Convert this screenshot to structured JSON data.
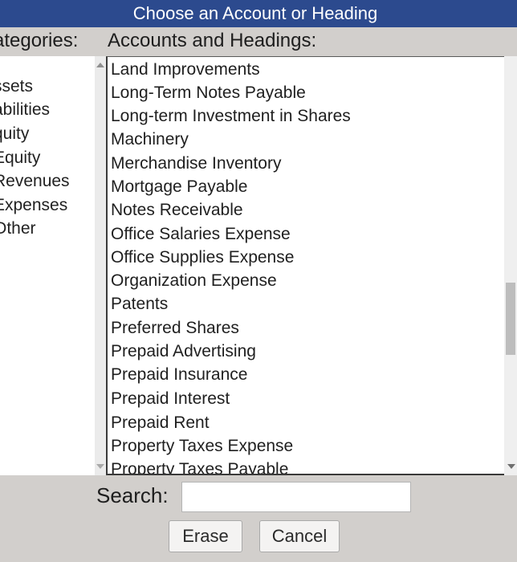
{
  "dialog": {
    "title": "Choose an Account or Heading"
  },
  "headers": {
    "categories": "ategories:",
    "accounts": "Accounts and Headings:"
  },
  "categories": [
    {
      "label": "l"
    },
    {
      "label": "ssets"
    },
    {
      "label": "abilities"
    },
    {
      "label": "quity"
    },
    {
      "label": "Equity"
    },
    {
      "label": "Revenues"
    },
    {
      "label": "Expenses"
    },
    {
      "label": "Other"
    }
  ],
  "accounts": [
    {
      "label": "Land Improvements"
    },
    {
      "label": "Long-Term Notes Payable"
    },
    {
      "label": "Long-term Investment in Shares"
    },
    {
      "label": "Machinery"
    },
    {
      "label": "Merchandise Inventory"
    },
    {
      "label": "Mortgage Payable"
    },
    {
      "label": "Notes Receivable"
    },
    {
      "label": "Office Salaries Expense"
    },
    {
      "label": "Office Supplies Expense"
    },
    {
      "label": "Organization Expense"
    },
    {
      "label": "Patents"
    },
    {
      "label": "Preferred Shares"
    },
    {
      "label": "Prepaid Advertising"
    },
    {
      "label": "Prepaid Insurance"
    },
    {
      "label": "Prepaid Interest"
    },
    {
      "label": "Prepaid Rent"
    },
    {
      "label": "Property Taxes Expense"
    },
    {
      "label": "Property Taxes Payable"
    }
  ],
  "search": {
    "label": "Search:",
    "value": ""
  },
  "buttons": {
    "erase": "Erase",
    "cancel": "Cancel"
  },
  "colors": {
    "titlebar": "#2c4a8e",
    "panel": "#d2cfcc"
  }
}
